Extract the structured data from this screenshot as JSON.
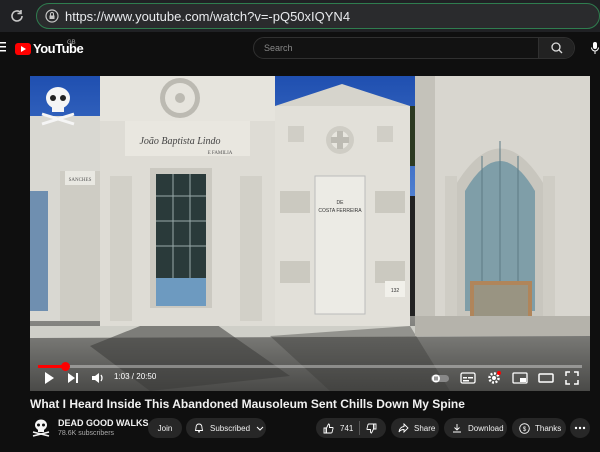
{
  "browser": {
    "url": "https://www.youtube.com/watch?v=-pQ50xIQYN4"
  },
  "header": {
    "logo_text": "YouTube",
    "country_code": "GB",
    "search_placeholder": "Search"
  },
  "player": {
    "progress_fraction": 0.05,
    "time_current": "1:03",
    "time_separator": " / ",
    "time_total": "20:50",
    "scene_text": {
      "left_tomb_name": "João Baptista Lindo",
      "left_tomb_sub": "E FAMILIA",
      "center_tomb_name_1": "DE",
      "center_tomb_name_2": "COSTA FERREIRA",
      "small_sign_left": "SANCHES",
      "small_sign_right": "132"
    }
  },
  "video": {
    "title": "What I Heard Inside This Abandoned Mausoleum Sent Chills Down My Spine"
  },
  "channel": {
    "name": "DEAD GOOD WALKS",
    "subscribers": "78.6K subscribers",
    "join_label": "Join",
    "subscribed_label": "Subscribed"
  },
  "actions": {
    "like_count": "741",
    "share_label": "Share",
    "download_label": "Download",
    "thanks_label": "Thanks"
  },
  "colors": {
    "accent": "#ff0000",
    "url_border": "#2f7d4f",
    "pill_bg": "#272727"
  }
}
